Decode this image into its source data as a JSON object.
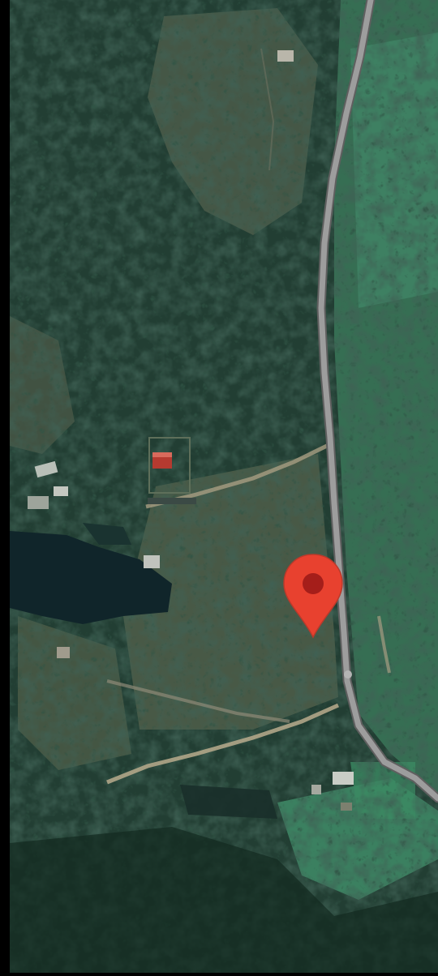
{
  "map": {
    "view": "satellite",
    "pin": {
      "icon": "location-pin-icon",
      "color": "#e53935",
      "inner_color": "#b71c1c"
    },
    "colors": {
      "forest": "#1e3a2e",
      "forest_dark": "#0f2219",
      "field": "#4a5a45",
      "meadow": "#3f8a66",
      "water": "#11252a",
      "road": "#9a9a9a",
      "track": "#b2a68a"
    }
  }
}
